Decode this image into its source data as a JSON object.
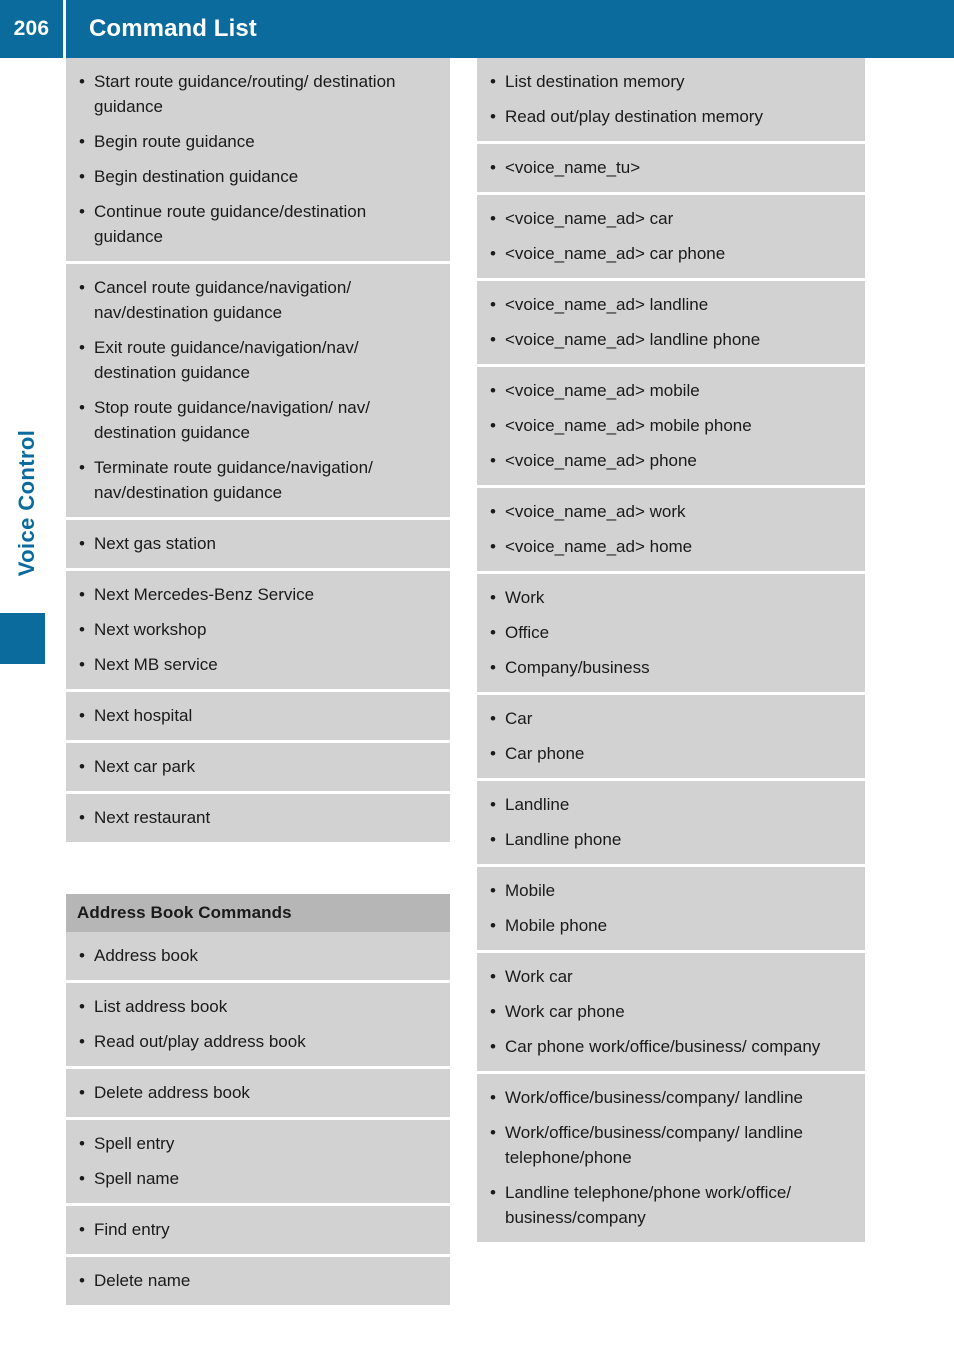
{
  "header": {
    "page_number": "206",
    "title": "Command List",
    "accent_color": "#0a6b9c"
  },
  "side_tab": {
    "chapter_label": "Voice Control",
    "marker_color": "#0a6b9c"
  },
  "colors": {
    "cell_background": "#d2d2d2",
    "section_header_background": "#b6b6b6",
    "text": "#1a1a1a",
    "page_background": "#ffffff"
  },
  "columns": {
    "left": {
      "groups": [
        {
          "type": "cells",
          "cells": [
            {
              "items": [
                "Start route guidance/routing/ destination guidance",
                "Begin route guidance",
                "Begin destination guidance",
                "Continue route guidance/destination guidance"
              ]
            },
            {
              "items": [
                "Cancel route guidance/navigation/ nav/destination guidance",
                "Exit route guidance/navigation/nav/ destination guidance",
                "Stop route guidance/navigation/ nav/ destination guidance",
                "Terminate route guidance/navigation/ nav/destination guidance"
              ]
            },
            {
              "items": [
                "Next gas station"
              ]
            },
            {
              "items": [
                "Next Mercedes-Benz Service",
                "Next workshop",
                "Next MB service"
              ]
            },
            {
              "items": [
                "Next hospital"
              ]
            },
            {
              "items": [
                "Next car park"
              ]
            },
            {
              "items": [
                "Next restaurant"
              ]
            }
          ]
        },
        {
          "type": "spacer"
        },
        {
          "type": "section",
          "title": "Address Book Commands",
          "cells": [
            {
              "items": [
                "Address book"
              ]
            },
            {
              "items": [
                "List address book",
                "Read out/play address book"
              ]
            },
            {
              "items": [
                "Delete address book"
              ]
            },
            {
              "items": [
                "Spell entry",
                "Spell name"
              ]
            },
            {
              "items": [
                "Find entry"
              ]
            },
            {
              "items": [
                "Delete name"
              ]
            }
          ]
        }
      ]
    },
    "right": {
      "groups": [
        {
          "type": "cells",
          "cells": [
            {
              "items": [
                "List destination memory",
                "Read out/play destination memory"
              ]
            },
            {
              "items": [
                "<voice_name_tu>"
              ]
            },
            {
              "items": [
                "<voice_name_ad> car",
                "<voice_name_ad> car phone"
              ]
            },
            {
              "items": [
                "<voice_name_ad> landline",
                "<voice_name_ad> landline phone"
              ]
            },
            {
              "items": [
                "<voice_name_ad> mobile",
                "<voice_name_ad> mobile phone",
                "<voice_name_ad> phone"
              ]
            },
            {
              "items": [
                "<voice_name_ad> work",
                "<voice_name_ad> home"
              ]
            },
            {
              "items": [
                "Work",
                "Office",
                "Company/business"
              ]
            },
            {
              "items": [
                "Car",
                "Car phone"
              ]
            },
            {
              "items": [
                "Landline",
                "Landline phone"
              ]
            },
            {
              "items": [
                "Mobile",
                "Mobile phone"
              ]
            },
            {
              "items": [
                "Work car",
                "Work car phone",
                "Car phone work/office/business/ company"
              ]
            },
            {
              "items": [
                "Work/office/business/company/ landline",
                "Work/office/business/company/ landline telephone/phone",
                "Landline telephone/phone work/office/ business/company"
              ]
            }
          ]
        }
      ]
    }
  },
  "bullet_glyph": "•"
}
